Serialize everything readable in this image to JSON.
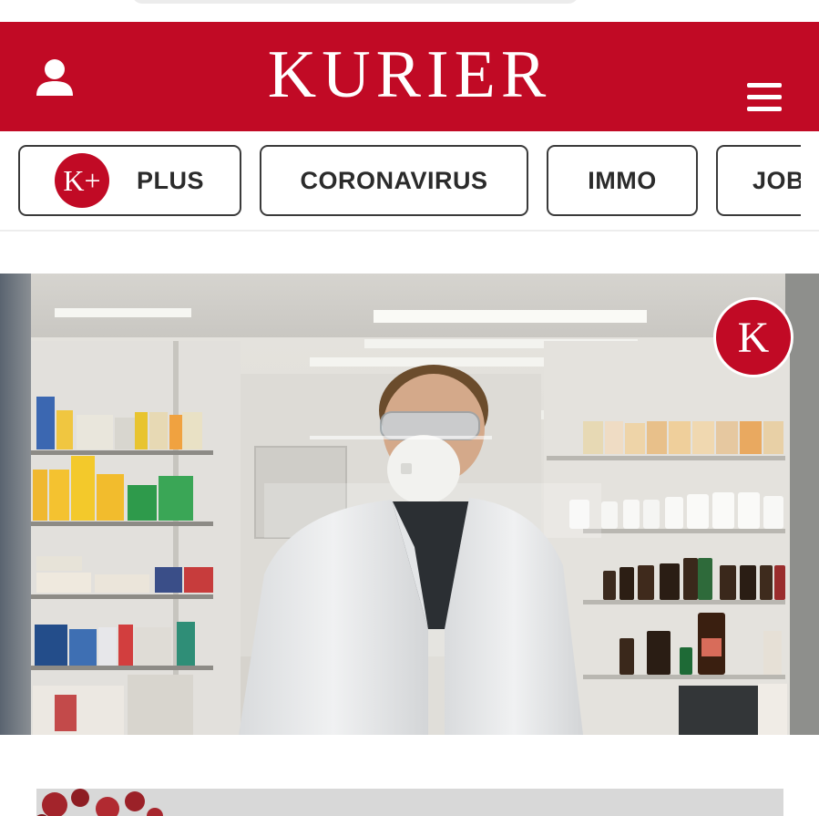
{
  "header": {
    "logo_text": "KURIER",
    "brand_color": "#c10a25",
    "user_icon": "user-icon",
    "menu_icon": "hamburger-menu-icon"
  },
  "nav": {
    "items": [
      {
        "label": "PLUS",
        "badge": "K+"
      },
      {
        "label": "CORONAVIRUS"
      },
      {
        "label": "IMMO"
      },
      {
        "label": "JOB"
      }
    ]
  },
  "hero": {
    "badge_text": "K"
  }
}
